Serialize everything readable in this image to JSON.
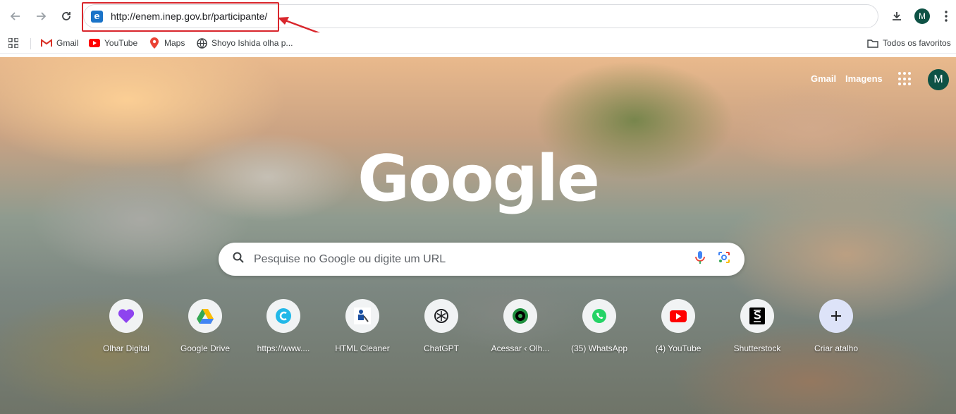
{
  "browser": {
    "address_bar": {
      "url": "http://enem.inep.gov.br/participante/"
    },
    "profile_initial": "M"
  },
  "bookmarks": {
    "items": [
      {
        "label": "Gmail",
        "icon": "gmail-icon"
      },
      {
        "label": "YouTube",
        "icon": "youtube-icon"
      },
      {
        "label": "Maps",
        "icon": "maps-icon"
      },
      {
        "label": "Shoyo Ishida olha p...",
        "icon": "globe-icon"
      }
    ],
    "all_bookmarks_label": "Todos os favoritos"
  },
  "newtab": {
    "top_links": {
      "gmail": "Gmail",
      "images": "Imagens"
    },
    "avatar_initial": "M",
    "logo": "Google",
    "search": {
      "placeholder": "Pesquise no Google ou digite um URL"
    },
    "shortcuts": [
      {
        "label": "Olhar Digital",
        "icon": "heart-icon"
      },
      {
        "label": "Google Drive",
        "icon": "drive-icon"
      },
      {
        "label": "https://www....",
        "icon": "c-letter-icon"
      },
      {
        "label": "HTML Cleaner",
        "icon": "cleaner-icon"
      },
      {
        "label": "ChatGPT",
        "icon": "chatgpt-icon"
      },
      {
        "label": "Acessar ‹ Olh...",
        "icon": "target-icon"
      },
      {
        "label": "(35) WhatsApp",
        "icon": "whatsapp-icon"
      },
      {
        "label": "(4) YouTube",
        "icon": "youtube-icon"
      },
      {
        "label": "Shutterstock",
        "icon": "shutterstock-icon"
      },
      {
        "label": "Criar atalho",
        "icon": "plus-icon"
      }
    ]
  },
  "colors": {
    "annotation": "#d9262c",
    "profile": "#0e5245"
  }
}
